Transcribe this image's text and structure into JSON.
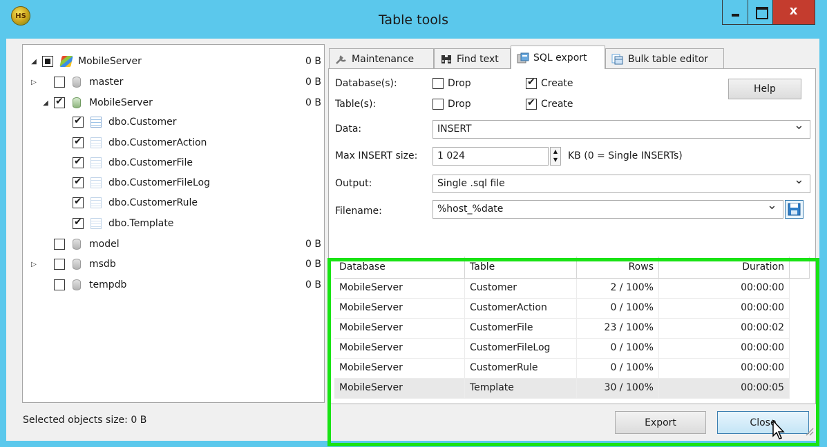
{
  "window": {
    "title": "Table tools",
    "app_icon_text": "HS",
    "close_glyph": "x"
  },
  "tree": {
    "root": {
      "label": "MobileServer",
      "size": "0 B"
    },
    "items": [
      {
        "label": "master",
        "size": "0 B"
      },
      {
        "label": "MobileServer",
        "size": "0 B"
      },
      {
        "label": "dbo.Customer"
      },
      {
        "label": "dbo.CustomerAction"
      },
      {
        "label": "dbo.CustomerFile"
      },
      {
        "label": "dbo.CustomerFileLog"
      },
      {
        "label": "dbo.CustomerRule"
      },
      {
        "label": "dbo.Template"
      },
      {
        "label": "model",
        "size": "0 B"
      },
      {
        "label": "msdb",
        "size": "0 B"
      },
      {
        "label": "tempdb",
        "size": "0 B"
      }
    ]
  },
  "status": {
    "text": "Selected objects size: 0 B"
  },
  "tabs": [
    {
      "label": "Maintenance",
      "icon": "wrench-icon"
    },
    {
      "label": "Find text",
      "icon": "binoculars-icon"
    },
    {
      "label": "SQL export",
      "icon": "export-icon"
    },
    {
      "label": "Bulk table editor",
      "icon": "table-editor-icon"
    }
  ],
  "form": {
    "databases_label": "Database(s):",
    "tables_label": "Table(s):",
    "drop_label": "Drop",
    "create_label": "Create",
    "help_label": "Help",
    "data_label": "Data:",
    "data_value": "INSERT",
    "max_insert_label": "Max INSERT size:",
    "max_insert_value": "1 024",
    "max_insert_unit": "KB (0 = Single INSERTs)",
    "output_label": "Output:",
    "output_value": "Single .sql file",
    "filename_label": "Filename:",
    "filename_value": "%host_%date"
  },
  "grid": {
    "columns": [
      "Database",
      "Table",
      "Rows",
      "Duration"
    ],
    "rows": [
      [
        "MobileServer",
        "Customer",
        "2 / 100%",
        "00:00:00"
      ],
      [
        "MobileServer",
        "CustomerAction",
        "0 / 100%",
        "00:00:00"
      ],
      [
        "MobileServer",
        "CustomerFile",
        "23 / 100%",
        "00:00:02"
      ],
      [
        "MobileServer",
        "CustomerFileLog",
        "0 / 100%",
        "00:00:00"
      ],
      [
        "MobileServer",
        "CustomerRule",
        "0 / 100%",
        "00:00:00"
      ],
      [
        "MobileServer",
        "Template",
        "30 / 100%",
        "00:00:05"
      ]
    ]
  },
  "buttons": {
    "export_label": "Export",
    "close_label": "Close"
  },
  "colors": {
    "titlebar": "#5bc8ec",
    "highlight": "#19e314",
    "close_button": "#c43c2e"
  }
}
